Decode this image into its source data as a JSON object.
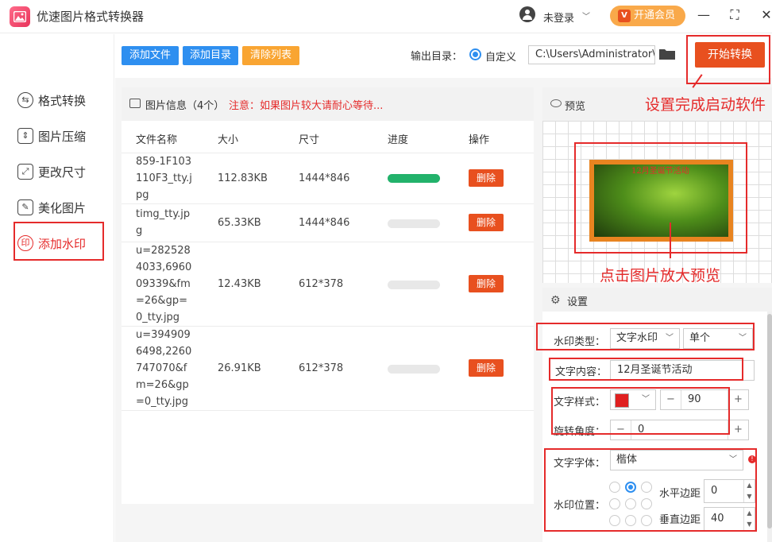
{
  "app": {
    "title": "优速图片格式转换器"
  },
  "header": {
    "login": "未登录",
    "vip": "开通会员",
    "vip_icon_text": "V"
  },
  "sidebar": {
    "items": [
      {
        "label": "格式转换",
        "icon": "swap-circle-icon"
      },
      {
        "label": "图片压缩",
        "icon": "compress-icon"
      },
      {
        "label": "更改尺寸",
        "icon": "resize-icon"
      },
      {
        "label": "美化图片",
        "icon": "beautify-icon"
      },
      {
        "label": "添加水印",
        "icon": "watermark-icon",
        "active": true
      }
    ]
  },
  "toolbar": {
    "add_file": "添加文件",
    "add_dir": "添加目录",
    "clear_list": "清除列表",
    "output_label": "输出目录：",
    "custom_label": "自定义",
    "output_path": "C:\\Users\\Administrator\\",
    "start": "开始转换"
  },
  "list": {
    "title": "图片信息（4个）",
    "note": "注意：如果图片较大请耐心等待...",
    "columns": [
      "文件名称",
      "大小",
      "尺寸",
      "进度",
      "操作"
    ],
    "rows": [
      {
        "name": "859-1F103110F3_tty.jpg",
        "size": "112.83KB",
        "dim": "1444*846",
        "progress": 1.0,
        "action": "删除"
      },
      {
        "name": "timg_tty.jpg",
        "size": "65.33KB",
        "dim": "1444*846",
        "progress": 0,
        "action": "删除"
      },
      {
        "name": "u=2825284033,696009339&fm=26&gp=0_tty.jpg",
        "size": "12.43KB",
        "dim": "612*378",
        "progress": 0,
        "action": "删除"
      },
      {
        "name": "u=3949096498,2260747070&fm=26&gp=0_tty.jpg",
        "size": "26.91KB",
        "dim": "612*378",
        "progress": 0,
        "action": "删除"
      }
    ]
  },
  "preview": {
    "title": "预览",
    "watermark_text": "12月圣诞节活动"
  },
  "annotations": {
    "start_hint": "设置完成启动软件",
    "preview_hint": "点击图片放大预览"
  },
  "settings": {
    "title": "设置",
    "watermark_type_label": "水印类型：",
    "watermark_type": "文字水印",
    "watermark_count": "单个",
    "text_content_label": "文字内容：",
    "text_content": "12月圣诞节活动",
    "text_style_label": "文字样式：",
    "text_color": "#e02020",
    "font_size": "90",
    "rotation_label": "旋转角度：",
    "rotation": "0",
    "font_label": "文字字体：",
    "font": "楷体",
    "position_label": "水印位置：",
    "h_margin_label": "水平边距",
    "h_margin": "0",
    "v_margin_label": "垂直边距",
    "v_margin": "40"
  },
  "colors": {
    "accent_blue": "#2e8ff0",
    "accent_orange": "#e8501f",
    "highlight_red": "#e52b2b",
    "progress_green": "#22b26b"
  }
}
